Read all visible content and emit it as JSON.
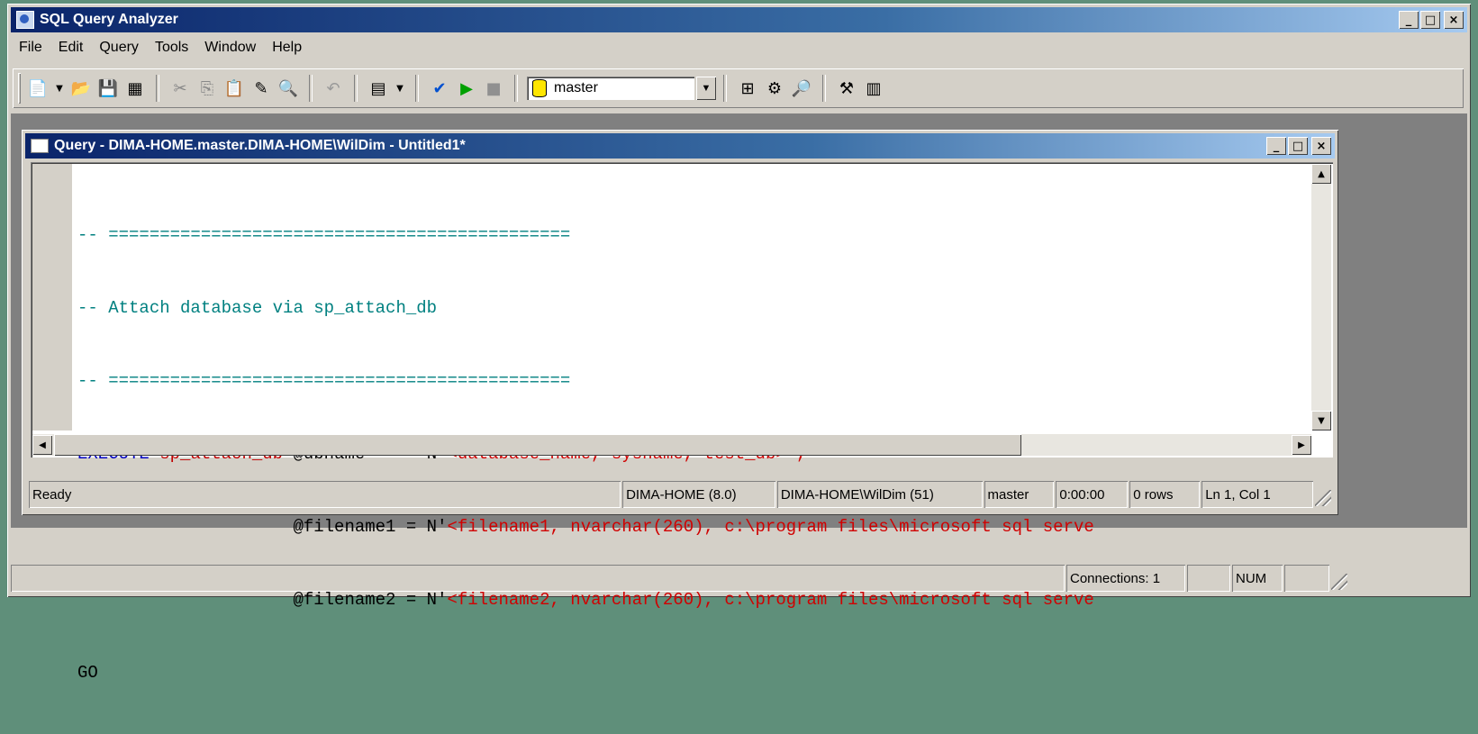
{
  "app": {
    "title": "SQL Query Analyzer",
    "window_buttons": [
      "_",
      "□",
      "×"
    ]
  },
  "menu": [
    "File",
    "Edit",
    "Query",
    "Tools",
    "Window",
    "Help"
  ],
  "toolbar": {
    "database": "master",
    "icons": [
      "new-query-icon",
      "dropdown-arrow-icon",
      "open-icon",
      "save-icon",
      "load-script-icon",
      "cut-icon",
      "copy-icon",
      "paste-icon",
      "edit-icon",
      "find-icon",
      "undo-icon",
      "results-grid-icon",
      "dropdown-arrow-icon",
      "parse-check-icon",
      "execute-icon",
      "cancel-icon",
      "database-icon",
      "object-browser-icon",
      "search-icon",
      "properties-icon",
      "table-icon"
    ]
  },
  "query_window": {
    "title": "Query - DIMA-HOME.master.DIMA-HOME\\WilDim - Untitled1*",
    "code_lines": [
      "-- =============================================",
      "-- Attach database via sp_attach_db",
      "-- =============================================",
      "EXECUTE sp_attach_db @dbname    = N'<database_name, sysname, test_db>',",
      "                     @filename1 = N'<filename1, nvarchar(260), c:\\program files\\microsoft sql serve",
      "                     @filename2 = N'<filename2, nvarchar(260), c:\\program files\\microsoft sql serve",
      "GO"
    ],
    "status": {
      "state": "Ready",
      "server": "DIMA-HOME (8.0)",
      "user": "DIMA-HOME\\WilDim (51)",
      "database": "master",
      "time": "0:00:00",
      "rows": "0 rows",
      "position": "Ln 1, Col 1"
    }
  },
  "bottom_status": {
    "connections": "Connections: 1",
    "num": "NUM"
  }
}
